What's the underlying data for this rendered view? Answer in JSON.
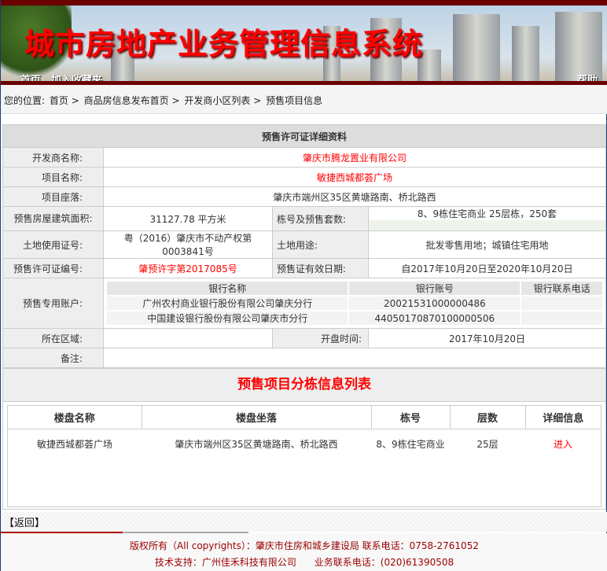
{
  "header": {
    "title": "城市房地产业务管理信息系统",
    "nav": [
      "首页",
      "加入收藏夹"
    ],
    "help": "帮助"
  },
  "breadcrumb": {
    "label": "您的位置:",
    "items": [
      "首页",
      "商品房信息发布首页",
      "开发商小区列表",
      "预售项目信息"
    ],
    "separator": ">"
  },
  "detail": {
    "title": "预售许可证详细资料",
    "developer_label": "开发商名称:",
    "developer": "肇庆市腾龙置业有限公司",
    "project_label": "项目名称:",
    "project": "敏捷西城都荟广场",
    "location_label": "项目座落:",
    "location": "肇庆市端州区35区黄塘路南、桥北路西",
    "area_label": "预售房屋建筑面积:",
    "area": "31127.78 平方米",
    "buildings_label": "栋号及预售套数:",
    "buildings": "8、9栋住宅商业 25层栋，250套",
    "land_cert_label": "土地使用证号:",
    "land_cert": "粤（2016）肇庆市不动产权第0003841号",
    "land_use_label": "土地用途:",
    "land_use": "批发零售用地；城镇住宅用地",
    "permit_label": "预售许可证编号:",
    "permit": "肇预许字第2017085号",
    "validity_label": "预售证有效日期:",
    "validity": "自2017年10月20日至2020年10月20日",
    "account_label": "预售专用账户:",
    "bank_headers": [
      "银行名称",
      "银行账号",
      "银行联系电话"
    ],
    "banks": [
      {
        "name": "广州农村商业银行股份有限公司肇庆分行",
        "account": "20021531000000486",
        "phone": ""
      },
      {
        "name": "中国建设银行股份有限公司肇庆市分行",
        "account": "44050170870100000506",
        "phone": ""
      }
    ],
    "district_label": "所在区域:",
    "district": "",
    "opening_label": "开盘时间:",
    "opening": "2017年10月20日",
    "remark_label": "备注:",
    "remark": ""
  },
  "list": {
    "title": "预售项目分栋信息列表",
    "headers": [
      "楼盘名称",
      "楼盘坐落",
      "栋号",
      "层数",
      "详细信息"
    ],
    "rows": [
      {
        "name": "敏捷西城都荟广场",
        "location": "肇庆市端州区35区黄塘路南、桥北路西",
        "building": "8、9栋住宅商业",
        "floors": "25层",
        "link": "进入"
      }
    ]
  },
  "back": "【返回】",
  "footer": {
    "line1": "版权所有（All copyrights）：肇庆市住房和城乡建设局 联系电话：0758-2761052",
    "line2a": "技术支持：广州佳禾科技有限公司",
    "line2b": "业务联系电话：(020)61390508"
  }
}
